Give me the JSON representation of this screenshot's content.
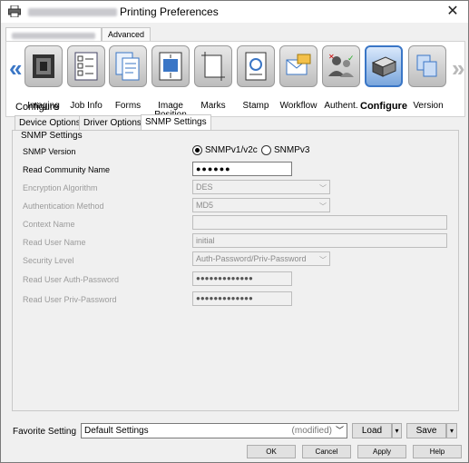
{
  "window": {
    "title": "Printing Preferences",
    "close_glyph": "✕"
  },
  "top_tabs": [
    {
      "label": "",
      "selected": true
    },
    {
      "label": "Advanced",
      "selected": false
    }
  ],
  "toolbar": {
    "left_arrow": "«",
    "right_arrow": "»",
    "items": [
      {
        "label": "Imaging",
        "icon": "imaging-icon",
        "selected": false
      },
      {
        "label": "Job Info",
        "icon": "job-info-icon",
        "selected": false
      },
      {
        "label": "Forms",
        "icon": "forms-icon",
        "selected": false
      },
      {
        "label": "Image\nPosition",
        "icon": "image-position-icon",
        "selected": false
      },
      {
        "label": "Marks",
        "icon": "marks-icon",
        "selected": false
      },
      {
        "label": "Stamp",
        "icon": "stamp-icon",
        "selected": false
      },
      {
        "label": "Workflow",
        "icon": "workflow-icon",
        "selected": false
      },
      {
        "label": "Authent.",
        "icon": "authentication-icon",
        "selected": false
      },
      {
        "label": "Configure",
        "icon": "configure-icon",
        "selected": true
      },
      {
        "label": "Version",
        "icon": "version-icon",
        "selected": false
      }
    ]
  },
  "configure": {
    "heading": "Configure",
    "tabs": [
      "Device Options",
      "Driver Options",
      "SNMP Settings"
    ],
    "active_tab": "SNMP Settings"
  },
  "snmp": {
    "heading": "SNMP Settings",
    "version_label": "SNMP Version",
    "version_options": [
      "SNMPv1/v2c",
      "SNMPv3"
    ],
    "version_selected": "SNMPv1/v2c",
    "read_community_label": "Read Community Name",
    "read_community_value": "●●●●●●",
    "encryption_label": "Encryption Algorithm",
    "encryption_value": "DES",
    "auth_method_label": "Authentication Method",
    "auth_method_value": "MD5",
    "context_name_label": "Context Name",
    "context_name_value": "",
    "read_user_name_label": "Read User Name",
    "read_user_name_value": "initial",
    "security_level_label": "Security Level",
    "security_level_value": "Auth-Password/Priv-Password",
    "auth_password_label": "Read User Auth-Password",
    "auth_password_value": "●●●●●●●●●●●●●",
    "priv_password_label": "Read User Priv-Password",
    "priv_password_value": "●●●●●●●●●●●●●"
  },
  "favorite": {
    "label": "Favorite Setting",
    "value": "Default Settings",
    "modified": "(modified)",
    "load_label": "Load",
    "save_label": "Save"
  },
  "buttons": {
    "ok": "OK",
    "cancel": "Cancel",
    "apply": "Apply",
    "help": "Help"
  },
  "colors": {
    "accent": "#3a76c6",
    "disabled_text": "#9b9b9b"
  }
}
